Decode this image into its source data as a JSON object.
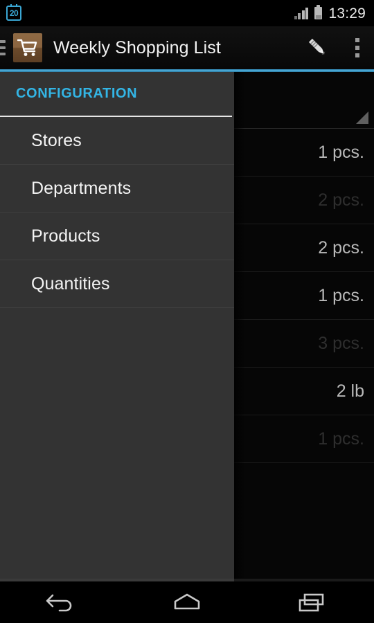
{
  "status_bar": {
    "calendar_badge": "20",
    "calendar_icon": "calendar-icon",
    "signal_icon": "signal-bars-icon",
    "battery_icon": "battery-icon",
    "clock": "13:29"
  },
  "action_bar": {
    "drawer_icon": "hamburger-menu-icon",
    "app_icon": "shopping-cart-icon",
    "title": "Weekly Shopping List",
    "edit_icon": "pencil-edit-icon",
    "overflow_icon": "overflow-menu-icon",
    "accent_color": "#33b5e5"
  },
  "drawer": {
    "header": "CONFIGURATION",
    "items": [
      {
        "label": "Stores"
      },
      {
        "label": "Departments"
      },
      {
        "label": "Products"
      },
      {
        "label": "Quantities"
      }
    ]
  },
  "content": {
    "spinner_label": "",
    "spinner_caret_icon": "dropdown-caret-icon",
    "rows": [
      {
        "name": "",
        "qty": "1 pcs.",
        "done": false
      },
      {
        "name": "",
        "qty": "2 pcs.",
        "done": true
      },
      {
        "name": "",
        "qty": "2 pcs.",
        "done": false
      },
      {
        "name": "",
        "qty": "1 pcs.",
        "done": false
      },
      {
        "name": "",
        "qty": "3 pcs.",
        "done": true
      },
      {
        "name": "",
        "qty": "2 lb",
        "done": false
      },
      {
        "name": "",
        "qty": "1 pcs.",
        "done": true
      }
    ]
  },
  "nav_bar": {
    "back_icon": "back-arrow-icon",
    "home_icon": "home-icon",
    "recents_icon": "recent-apps-icon"
  }
}
